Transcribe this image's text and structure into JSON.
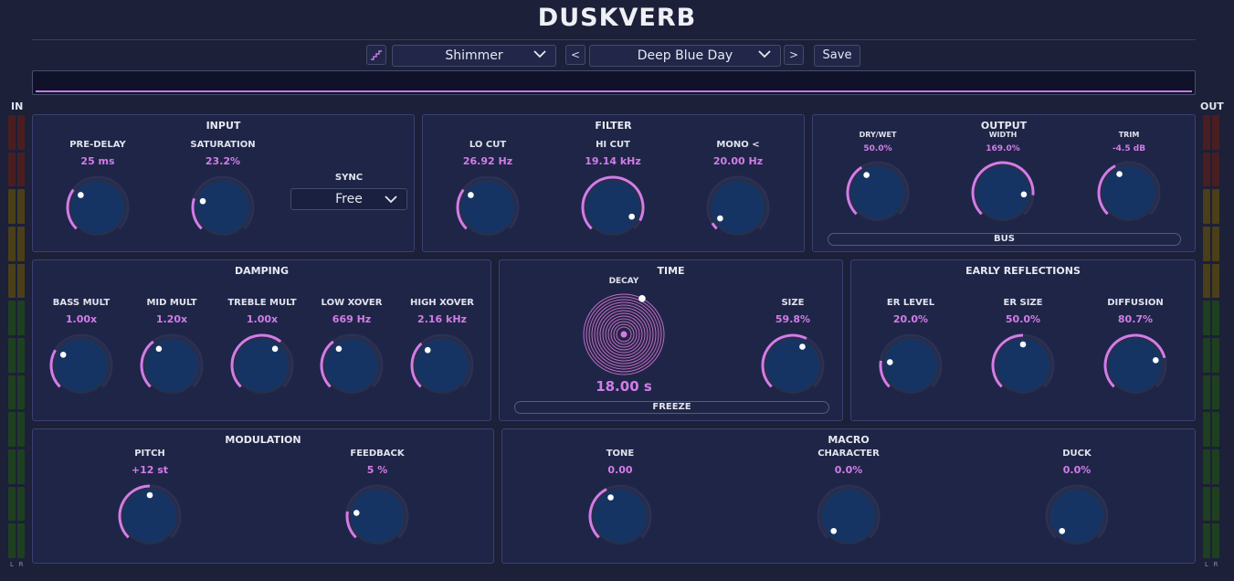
{
  "app_title": "DUSKVERB",
  "toolbar": {
    "left_icon": "stairs-icon",
    "algorithm": "Shimmer",
    "prev_label": "<",
    "preset": "Deep Blue Day",
    "next_label": ">",
    "save_label": "Save"
  },
  "meters": {
    "in_label": "IN",
    "out_label": "OUT",
    "l_label": "L",
    "r_label": "R"
  },
  "colors": {
    "accent": "#d27ce9",
    "knob_fill": "#163463",
    "background": "#1c2038",
    "panel": "#1f2546"
  },
  "input": {
    "title": "INPUT",
    "predelay": {
      "label": "PRE-DELAY",
      "value": "25 ms",
      "pos": 0.3
    },
    "saturation": {
      "label": "SATURATION",
      "value": "23.2%",
      "pos": 0.23
    },
    "sync": {
      "label": "SYNC",
      "value": "Free"
    }
  },
  "filter": {
    "title": "FILTER",
    "locut": {
      "label": "LO CUT",
      "value": "26.92 Hz",
      "pos": 0.3
    },
    "hicut": {
      "label": "HI CUT",
      "value": "19.14 kHz",
      "pos": 0.93
    },
    "mono": {
      "label": "MONO <",
      "value": "20.00 Hz",
      "pos": 0.05
    }
  },
  "output": {
    "title": "OUTPUT",
    "drywet": {
      "label": "DRY/WET",
      "value": "50.0%",
      "pos": 0.38
    },
    "width": {
      "label": "WIDTH",
      "value": "169.0%",
      "pos": 0.85
    },
    "trim": {
      "label": "TRIM",
      "value": "-4.5 dB",
      "pos": 0.4
    },
    "bus_label": "BUS"
  },
  "damping": {
    "title": "DAMPING",
    "bass": {
      "label": "BASS MULT",
      "value": "1.00x",
      "pos": 0.28
    },
    "mid": {
      "label": "MID MULT",
      "value": "1.20x",
      "pos": 0.36
    },
    "treble": {
      "label": "TREBLE MULT",
      "value": "1.00x",
      "pos": 0.64
    },
    "lowx": {
      "label": "LOW XOVER",
      "value": "669 Hz",
      "pos": 0.36
    },
    "highx": {
      "label": "HIGH XOVER",
      "value": "2.16 kHz",
      "pos": 0.34
    }
  },
  "time": {
    "title": "TIME",
    "decay": {
      "label": "DECAY",
      "value": "18.00 s",
      "pos": 0.6
    },
    "size": {
      "label": "SIZE",
      "value": "59.8%",
      "pos": 0.6
    },
    "freeze_label": "FREEZE"
  },
  "early": {
    "title": "EARLY REFLECTIONS",
    "level": {
      "label": "ER LEVEL",
      "value": "20.0%",
      "pos": 0.2
    },
    "size": {
      "label": "ER SIZE",
      "value": "50.0%",
      "pos": 0.5
    },
    "diffusion": {
      "label": "DIFFUSION",
      "value": "80.7%",
      "pos": 0.78
    }
  },
  "modulation": {
    "title": "MODULATION",
    "pitch": {
      "label": "PITCH",
      "value": "+12 st",
      "pos": 0.5
    },
    "feedback": {
      "label": "FEEDBACK",
      "value": "5 %",
      "pos": 0.2
    }
  },
  "macro": {
    "title": "MACRO",
    "tone": {
      "label": "TONE",
      "value": "0.00",
      "pos": 0.4
    },
    "character": {
      "label": "CHARACTER",
      "value": "0.0%",
      "pos": 0.0
    },
    "duck": {
      "label": "DUCK",
      "value": "0.0%",
      "pos": 0.0
    }
  }
}
